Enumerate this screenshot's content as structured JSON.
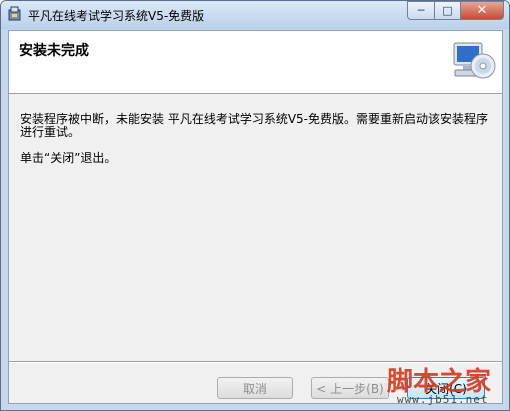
{
  "window": {
    "title": "平凡在线考试学习系统V5-免费版",
    "min_glyph": "─",
    "max_glyph": "□",
    "close_glyph": "✕"
  },
  "header": {
    "title": "安装未完成"
  },
  "body": {
    "message": "安装程序被中断，未能安装 平凡在线考试学习系统V5-免费版。需要重新启动该安装程序进行重试。",
    "instruction": "单击“关闭”退出。"
  },
  "buttons": {
    "cancel": "取消",
    "back": "< 上一步(B)",
    "close": "关闭(C)"
  },
  "watermark": {
    "text": "脚本之家",
    "url": "www.jb51.net"
  },
  "icons": {
    "app": "installer-icon",
    "header": "computer-cd-icon"
  },
  "colors": {
    "title_bg": "#c7d8ec",
    "close_red": "#c74a35",
    "watermark": "#d8371a"
  }
}
